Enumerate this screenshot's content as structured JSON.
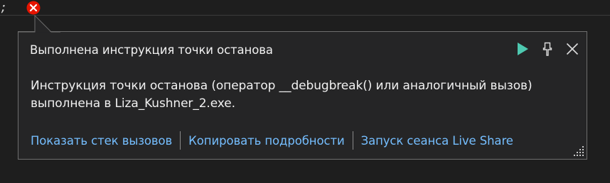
{
  "editor": {
    "code_fragment": ";"
  },
  "icons": {
    "breakpoint": "error-circle-icon",
    "continue": "play-icon",
    "pin": "pin-icon",
    "close": "close-icon",
    "resize": "resize-grip-icon"
  },
  "colors": {
    "background": "#1e1e1e",
    "popup_background": "#252526",
    "popup_border": "#6e6e6e",
    "error": "#e51400",
    "play": "#4ec9b0",
    "link": "#75beff",
    "text": "#f1f1f1"
  },
  "exception_popup": {
    "title": "Выполнена инструкция точки останова",
    "message": "Инструкция точки останова (оператор __debugbreak() или аналогичный вызов) выполнена в Liza_Kushner_2.exe.",
    "links": [
      "Показать стек вызовов",
      "Копировать подробности",
      "Запуск сеанса Live Share"
    ]
  }
}
